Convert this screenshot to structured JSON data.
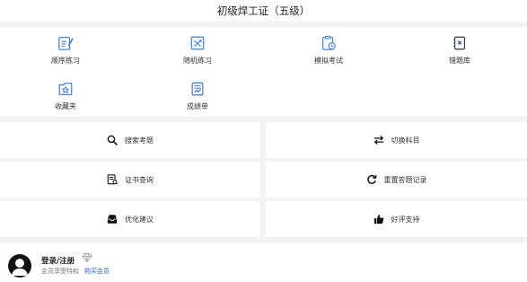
{
  "header": {
    "title": "初级焊工证（五级）"
  },
  "grid": {
    "items": [
      {
        "label": "顺序练习",
        "icon": "sequence-practice-icon"
      },
      {
        "label": "随机练习",
        "icon": "random-practice-icon"
      },
      {
        "label": "模拟考试",
        "icon": "mock-exam-icon"
      },
      {
        "label": "错题库",
        "icon": "wrong-questions-icon"
      },
      {
        "label": "收藏夹",
        "icon": "favorites-icon"
      },
      {
        "label": "成绩单",
        "icon": "transcript-icon"
      }
    ]
  },
  "tiles": [
    {
      "label": "搜索考题",
      "icon": "search-icon"
    },
    {
      "label": "切换科目",
      "icon": "swap-icon"
    },
    {
      "label": "证书查询",
      "icon": "certificate-icon"
    },
    {
      "label": "重置答题记录",
      "icon": "reset-icon"
    },
    {
      "label": "优化建议",
      "icon": "inbox-icon"
    },
    {
      "label": "好评支持",
      "icon": "thumbs-up-icon"
    }
  ],
  "user": {
    "login_label": "登录/注册",
    "vip_text": "会员享受特权",
    "buy_label": "购买会员"
  },
  "colors": {
    "accent": "#2e63c8",
    "icon_blue": "#3a7bd5",
    "background": "#f2f3f5"
  }
}
